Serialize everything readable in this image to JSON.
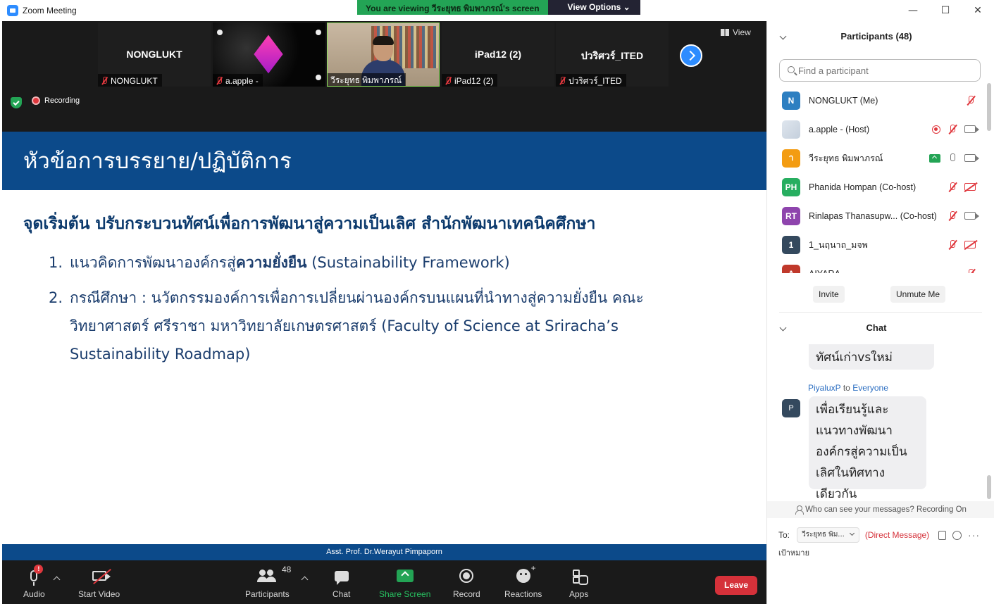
{
  "window": {
    "title": "Zoom Meeting",
    "viewing_banner": "You are viewing วีระยุทธ พิมพาภรณ์'s screen",
    "view_options": "View Options ⌄",
    "controls": [
      "—",
      "☐",
      "✕"
    ]
  },
  "gallery": {
    "tiles": [
      {
        "name": "NONGLUKT",
        "label": "NONGLUKT",
        "type": "name"
      },
      {
        "name": "",
        "label": "a.apple -",
        "type": "space"
      },
      {
        "name": "",
        "label": "วีระยุทธ พิมพาภรณ์",
        "type": "video"
      },
      {
        "name": "iPad12 (2)",
        "label": "iPad12 (2)",
        "type": "name"
      },
      {
        "name": "ปวริศวร์_ITED",
        "label": "ปวริศวร์_ITED",
        "type": "name"
      }
    ],
    "view_label": "View",
    "recording_label": "Recording"
  },
  "slide": {
    "title": "หัวข้อการบรรยาย/ปฏิบัติการ",
    "heading": "จุดเริ่มต้น ปรับกระบวนทัศน์เพื่อการพัฒนาสู่ความเป็นเลิศ สำนักพัฒนาเทคนิคศึกษา",
    "items": [
      {
        "num": "1.",
        "pre": "แนวคิดการพัฒนาองค์กรสู่",
        "bold": "ความยั่งยืน",
        "post": " (Sustainability Framework)"
      },
      {
        "num": "2.",
        "pre": "กรณีศึกษา : นวัตกรรมองค์การเพื่อการเปลี่ยนผ่านองค์กรบนแผนที่นำทางสู่ความยั่งยืน คณะวิทยาศาสตร์ ศรีราชา มหาวิทยาลัยเกษตรศาสตร์ (Faculty of Science at Sriracha’s Sustainability Roadmap)",
        "bold": "",
        "post": ""
      }
    ]
  },
  "speaker_name": "Asst. Prof. Dr.Werayut Pimpaporn",
  "toolbar": {
    "audio": "Audio",
    "audio_badge": "!",
    "start_video": "Start Video",
    "participants": "Participants",
    "participants_count": "48",
    "chat": "Chat",
    "share_screen": "Share Screen",
    "record": "Record",
    "reactions": "Reactions",
    "apps": "Apps",
    "leave": "Leave"
  },
  "participants_panel": {
    "header": "Participants (48)",
    "search_placeholder": "Find a participant",
    "list": [
      {
        "initials": "N",
        "color": "#2d7fc1",
        "name": "NONGLUKT (Me)",
        "status": [
          "mic-off"
        ]
      },
      {
        "initials": "",
        "color": "#ffffff",
        "name": "a.apple - (Host)",
        "status": [
          "rec",
          "mic-off",
          "cam"
        ]
      },
      {
        "initials": "า",
        "color": "#f39c12",
        "name": "วีระยุทธ พิมพาภรณ์",
        "status": [
          "share",
          "mic-on",
          "cam"
        ]
      },
      {
        "initials": "PH",
        "color": "#27ae60",
        "name": "Phanida Hompan (Co-host)",
        "status": [
          "mic-off",
          "cam-off"
        ]
      },
      {
        "initials": "RT",
        "color": "#8e44ad",
        "name": "Rinlapas Thanasupw...  (Co-host)",
        "status": [
          "mic-off",
          "cam"
        ]
      },
      {
        "initials": "1",
        "color": "#34495e",
        "name": "1_นฤนาถ_มจพ",
        "status": [
          "mic-off",
          "cam-off"
        ]
      },
      {
        "initials": "A",
        "color": "#c0392b",
        "name": "AIYARA",
        "status": [
          "mic-off"
        ]
      }
    ],
    "invite": "Invite",
    "unmute_me": "Unmute Me"
  },
  "chat_panel": {
    "header": "Chat",
    "prev_message": "ทัศน์เก่าvsใหม่",
    "sender": "PiyaluxP",
    "sender_to": "to",
    "recipient": "Everyone",
    "avatar": "P",
    "message": "เพื่อเรียนรู้และแนวทางพัฒนาองค์กรสู่ความเป็นเลิศในทิศทางเดียวกัน",
    "who_can_see": "Who can see your messages? Recording On",
    "to_label": "To:",
    "to_value": "วีระยุทธ พิม...",
    "direct_message": "(Direct Message)",
    "input_value": "เป้าหมาย",
    "more": "···"
  },
  "colors": {
    "slide_blue": "#0c4a8a",
    "zoom_blue": "#2d8cff",
    "share_green": "#23a455",
    "leave_red": "#d5313a"
  }
}
